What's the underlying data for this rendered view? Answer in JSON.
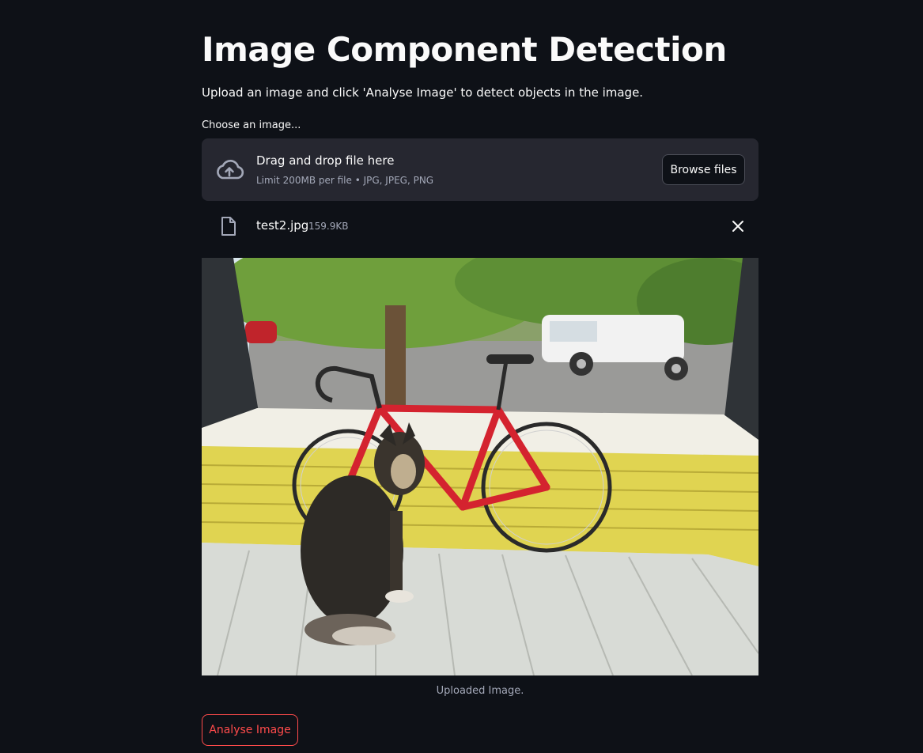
{
  "page": {
    "title": "Image Component Detection",
    "description": "Upload an image and click 'Analyse Image' to detect objects in the image."
  },
  "uploader": {
    "label": "Choose an image...",
    "dropzone_title": "Drag and drop file here",
    "dropzone_limit": "Limit 200MB per file • JPG, JPEG, PNG",
    "browse_label": "Browse files",
    "upload_icon": "cloud-upload-icon"
  },
  "file": {
    "name": "test2.jpg",
    "size": "159.9KB",
    "file_icon": "file-icon",
    "remove_icon": "close-icon"
  },
  "image": {
    "caption": "Uploaded Image."
  },
  "actions": {
    "analyse_label": "Analyse Image"
  },
  "colors": {
    "background": "#0e1117",
    "dropzone": "#262730",
    "accent": "#ff4b4b",
    "muted_text": "#a3a8b8"
  }
}
